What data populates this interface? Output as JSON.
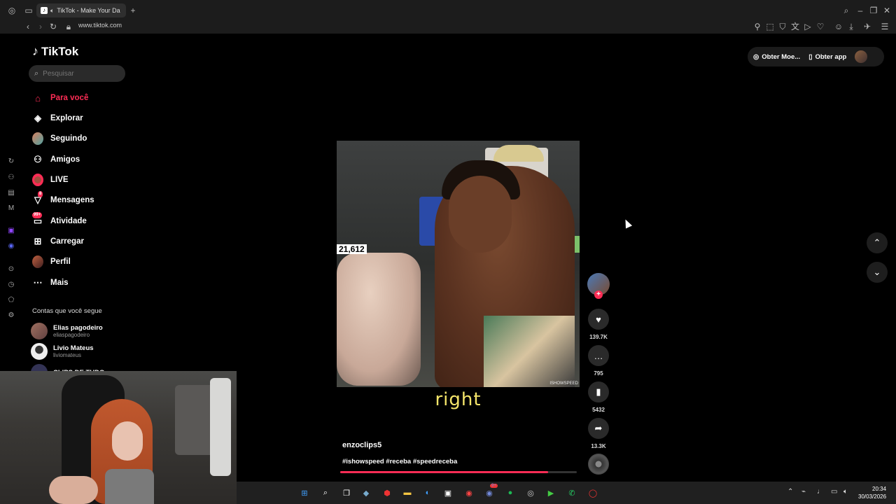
{
  "browser": {
    "tab_title": "TikTok - Make Your Da",
    "url": "www.tiktok.com",
    "new_tab_icon": "plus-icon"
  },
  "tiktok": {
    "logo_text": "TikTok",
    "search_placeholder": "Pesquisar",
    "nav": [
      {
        "label": "Para você",
        "icon": "home-icon",
        "active": true
      },
      {
        "label": "Explorar",
        "icon": "compass-icon"
      },
      {
        "label": "Seguindo",
        "icon": "following-avatar-icon"
      },
      {
        "label": "Amigos",
        "icon": "friends-icon"
      },
      {
        "label": "LIVE",
        "icon": "live-icon"
      },
      {
        "label": "Mensagens",
        "icon": "messages-icon",
        "badge": "8"
      },
      {
        "label": "Atividade",
        "icon": "activity-icon",
        "badge": "99+"
      },
      {
        "label": "Carregar",
        "icon": "upload-icon"
      },
      {
        "label": "Perfil",
        "icon": "profile-avatar-icon"
      },
      {
        "label": "Mais",
        "icon": "more-icon"
      }
    ],
    "following_title": "Contas que você segue",
    "following": [
      {
        "name": "Elias pagodeiro",
        "username": "eliaspagodeiro"
      },
      {
        "name": "Livio Mateus",
        "username": "liviomateus"
      },
      {
        "name": "CLIPS DE TUDO",
        "username": ""
      }
    ],
    "top_right": {
      "coins_label": "Obter Moe...",
      "app_label": "Obter app"
    },
    "video": {
      "overlay_counter": "21,612",
      "watermark": "ISHOWSPEED",
      "caption": "right",
      "author": "enzoclips5",
      "hashtags": "#ishowspeed #receba #speedreceba",
      "progress": 0.88
    },
    "actions": {
      "likes": "139.7K",
      "comments": "795",
      "saves": "5432",
      "shares": "13.3K"
    }
  },
  "taskbar": {
    "time": "20:34",
    "date": "30/03/2026",
    "badge": "9+"
  }
}
